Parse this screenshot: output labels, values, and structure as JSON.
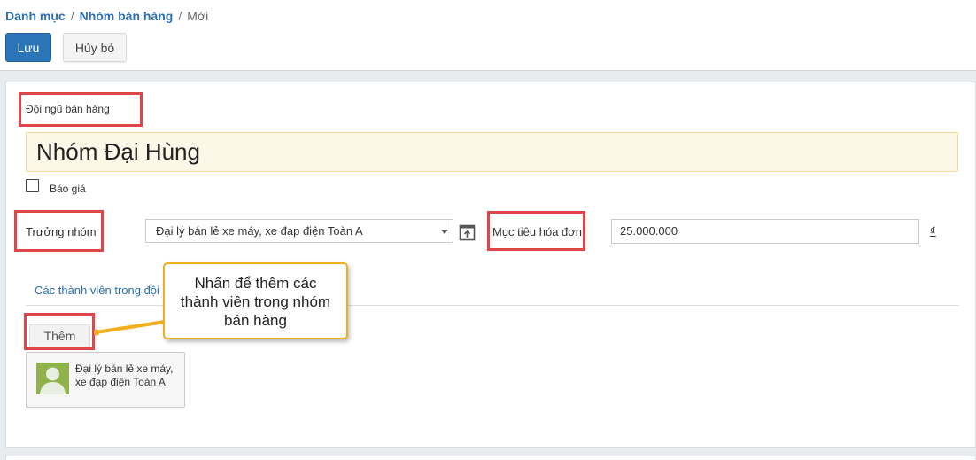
{
  "breadcrumb": {
    "items": [
      "Danh mục",
      "Nhóm bán hàng"
    ],
    "current": "Mới",
    "separator": "/"
  },
  "toolbar": {
    "save_label": "Lưu",
    "cancel_label": "Hủy bỏ"
  },
  "form": {
    "team_label": "Đội ngũ bán hàng",
    "team_name": "Nhóm Đại Hùng",
    "quotation_label": "Báo giá",
    "quotation_checked": false,
    "leader_label": "Trưởng nhóm",
    "leader_value": "Đại lý bán lẻ xe máy, xe đạp điện Toàn A",
    "invoice_target_label": "Mục tiêu hóa đơn",
    "invoice_target_value": "25.000.000",
    "currency_symbol": "₫"
  },
  "tabs": {
    "members_tab": "Các thành viên trong đội"
  },
  "members": {
    "add_label": "Thêm",
    "cards": [
      {
        "name_line1": "Đại lý bán lẻ xe máy,",
        "name_line2": "xe đạp điện Toàn A"
      }
    ]
  },
  "callout": {
    "line1": "Nhấn để thêm các",
    "line2": "thành viên trong nhóm",
    "line3": "bán hàng"
  },
  "colors": {
    "primary": "#2a74b8",
    "link": "#2a6fb0",
    "highlight_box": "#e0454a",
    "callout_border": "#f1ae1e",
    "name_field_bg": "#fdf7e8"
  },
  "icons": {
    "external_link": "external-link-icon",
    "dropdown": "chevron-down-icon",
    "avatar": "user-avatar-icon"
  }
}
